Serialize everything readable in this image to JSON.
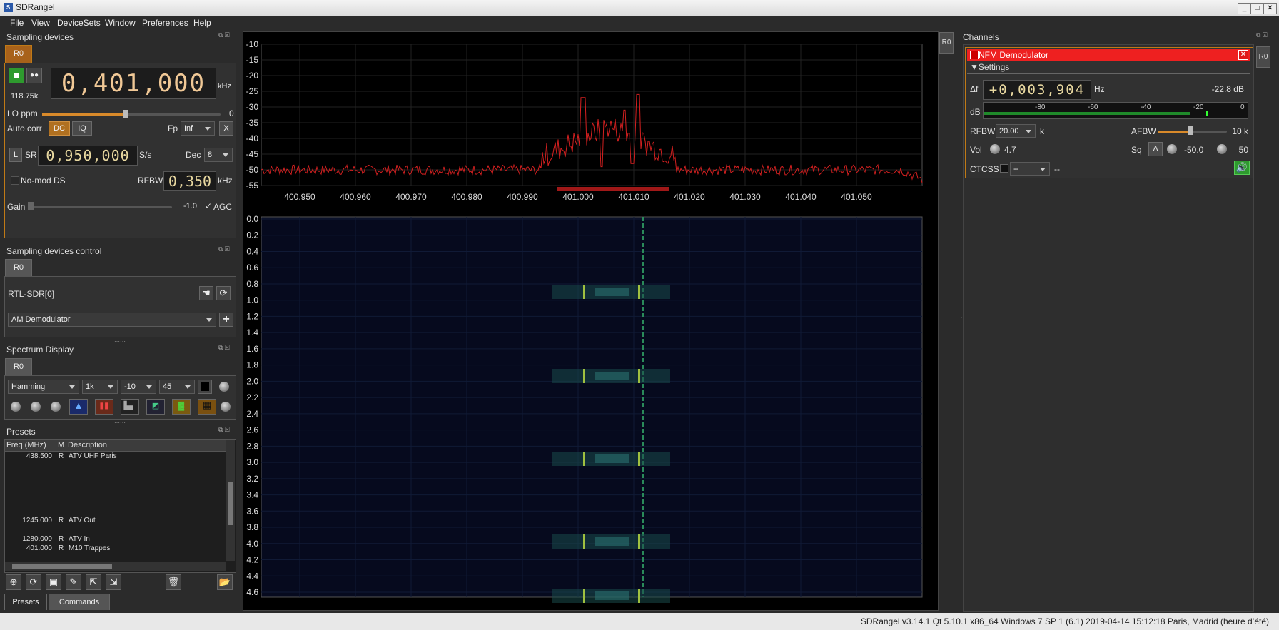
{
  "window": {
    "title": "SDRangel",
    "icon_label": "S"
  },
  "menu": [
    {
      "label": "File"
    },
    {
      "label": "View"
    },
    {
      "label": "DeviceSets"
    },
    {
      "label": "Window"
    },
    {
      "label": "Preferences"
    },
    {
      "label": "Help"
    }
  ],
  "sampling_devices": {
    "title": "Sampling devices",
    "tab": "R0",
    "center_freq": "0,401,000",
    "freq_unit": "kHz",
    "sample_rate_display": "118.75k",
    "lo_ppm_label": "LO ppm",
    "lo_ppm_value": "0",
    "auto_corr_label": "Auto corr",
    "dc_label": "DC",
    "iq_label": "IQ",
    "fp_label": "Fp",
    "fp_value": "Inf",
    "x_label": "X",
    "l_label": "L",
    "sr_label": "SR",
    "sr_value": "0,950,000",
    "sr_unit": "S/s",
    "dec_label": "Dec",
    "dec_value": "8",
    "nomod_label": "No-mod DS",
    "rfbw_label": "RFBW",
    "rfbw_value": "0,350",
    "rfbw_unit": "kHz",
    "gain_label": "Gain",
    "gain_value": "-1.0",
    "agc_label": "AGC"
  },
  "sampling_devices_control": {
    "title": "Sampling devices control",
    "tab": "R0",
    "device": "RTL-SDR[0]",
    "channel_select": "AM Demodulator"
  },
  "spectrum_display": {
    "title": "Spectrum Display",
    "tab": "R0",
    "window_fn": "Hamming",
    "fft_size": "1k",
    "ref_level": "-10",
    "range": "45"
  },
  "presets": {
    "title": "Presets",
    "columns": [
      "Freq (MHz)",
      "M",
      "Description"
    ],
    "rows": [
      {
        "freq": "438.500",
        "mode": "R",
        "desc": "ATV UHF Paris"
      },
      {
        "freq": "1245.000",
        "mode": "R",
        "desc": "ATV Out"
      },
      {
        "freq": "1280.000",
        "mode": "R",
        "desc": "ATV In"
      },
      {
        "freq": "401.000",
        "mode": "R",
        "desc": "M10 Trappes"
      }
    ],
    "tabs": [
      "Presets",
      "Commands"
    ]
  },
  "spectrum": {
    "y_ticks": [
      "-10",
      "-15",
      "-20",
      "-25",
      "-30",
      "-35",
      "-40",
      "-45",
      "-50",
      "-55"
    ],
    "x_ticks": [
      "400.950",
      "400.960",
      "400.970",
      "400.980",
      "400.990",
      "401.000",
      "401.010",
      "401.020",
      "401.030",
      "401.040",
      "401.050"
    ],
    "trace_color": "#d42020"
  },
  "waterfall": {
    "y_ticks": [
      "0.0",
      "0.2",
      "0.4",
      "0.6",
      "0.8",
      "1.0",
      "1.2",
      "1.4",
      "1.6",
      "1.8",
      "2.0",
      "2.2",
      "2.4",
      "2.6",
      "2.8",
      "3.0",
      "3.2",
      "3.4",
      "3.6",
      "3.8",
      "4.0",
      "4.2",
      "4.4",
      "4.6"
    ]
  },
  "side_tabs": {
    "left": "R0",
    "right": "R0"
  },
  "channels": {
    "title": "Channels",
    "nfm": {
      "title": "NFM Demodulator",
      "title_color": "#ee2020",
      "settings_label": "Settings",
      "delta_f_label": "Δf",
      "delta_f_value": "+0,003,904",
      "delta_f_unit": "Hz",
      "power": "-22.8 dB",
      "db_label": "dB",
      "meter_labels": [
        "-80",
        "-60",
        "-40",
        "-20",
        "0"
      ],
      "rfbw_label": "RFBW",
      "rfbw_value": "20.00",
      "rfbw_unit": "k",
      "afbw_label": "AFBW",
      "afbw_value": "10 k",
      "vol_label": "Vol",
      "vol_value": "4.7",
      "sq_label": "Sq",
      "sq_delta": "Δ",
      "sq_value": "-50.0",
      "sq_gate": "50",
      "ctcss_label": "CTCSS",
      "ctcss_value": "--",
      "ctcss_readout": "--"
    }
  },
  "status": {
    "text": "SDRangel v3.14.1 Qt 5.10.1 x86_64 Windows 7 SP 1 (6.1)  2019-04-14 15:12:18 Paris, Madrid (heure d’été)"
  }
}
